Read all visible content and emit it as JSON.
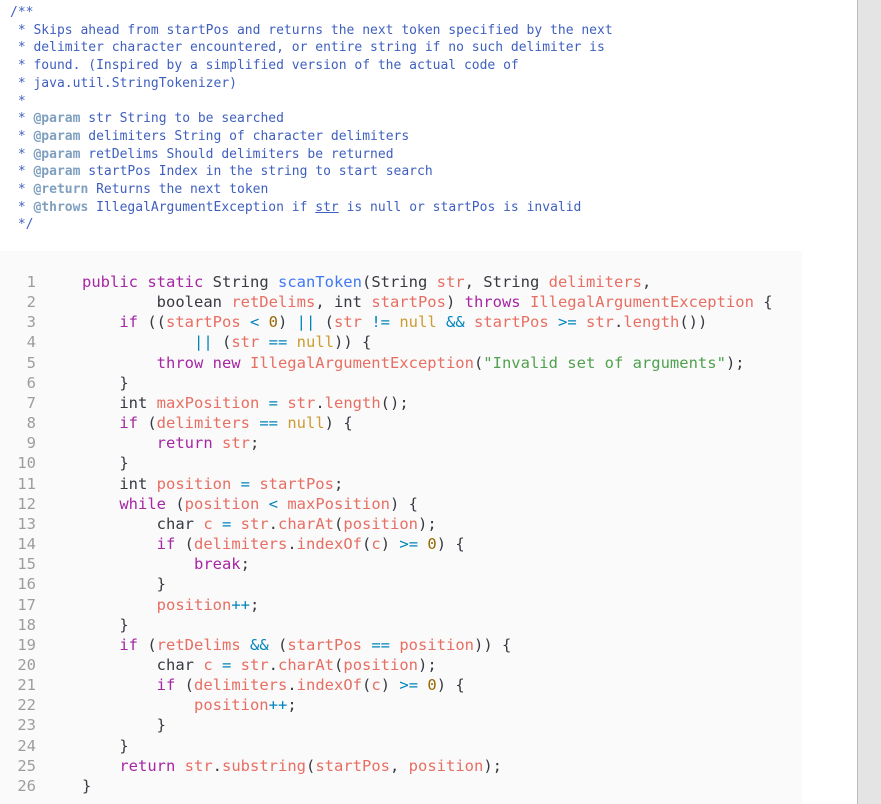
{
  "javadoc": {
    "open": "/**",
    "lines": [
      " * Skips ahead from startPos and returns the next token specified by the next",
      " * delimiter character encountered, or entire string if no such delimiter is",
      " * found. (Inspired by a simplified version of the actual code of",
      " * java.util.StringTokenizer)",
      " *"
    ],
    "tags": [
      {
        "tag": "@param",
        "text": " str String to be searched"
      },
      {
        "tag": "@param",
        "text": " delimiters String of character delimiters"
      },
      {
        "tag": "@param",
        "text": " retDelims Should delimiters be returned"
      },
      {
        "tag": "@param",
        "text": " startPos Index in the string to start search"
      },
      {
        "tag": "@return",
        "text": " Returns the next token"
      },
      {
        "tag": "@throws",
        "text_pre": " IllegalArgumentException if ",
        "underlined": "str",
        "text_post": " is null or startPos is invalid"
      }
    ],
    "close": " */"
  },
  "code": {
    "line_numbers": [
      "1",
      "2",
      "3",
      "4",
      "5",
      "6",
      "7",
      "8",
      "9",
      "10",
      "11",
      "12",
      "13",
      "14",
      "15",
      "16",
      "17",
      "18",
      "19",
      "20",
      "21",
      "22",
      "23",
      "24",
      "25",
      "26"
    ],
    "lines": [
      [
        [
          "kw",
          "public static "
        ],
        [
          "t",
          "String "
        ],
        [
          "fn",
          "scanToken"
        ],
        [
          "t",
          "(String "
        ],
        [
          "var",
          "str"
        ],
        [
          "t",
          ", String "
        ],
        [
          "var",
          "delimiters"
        ],
        [
          "t",
          ","
        ]
      ],
      [
        [
          "t",
          "        boolean "
        ],
        [
          "var",
          "retDelims"
        ],
        [
          "t",
          ", int "
        ],
        [
          "var",
          "startPos"
        ],
        [
          "t",
          ") "
        ],
        [
          "kw",
          "throws "
        ],
        [
          "var",
          "IllegalArgumentException"
        ],
        [
          "t",
          " {"
        ]
      ],
      [
        [
          "t",
          "    "
        ],
        [
          "kw",
          "if "
        ],
        [
          "t",
          "(("
        ],
        [
          "var",
          "startPos"
        ],
        [
          "op",
          " < "
        ],
        [
          "num",
          "0"
        ],
        [
          "t",
          ") "
        ],
        [
          "op",
          "||"
        ],
        [
          "t",
          " ("
        ],
        [
          "var",
          "str"
        ],
        [
          "op",
          " != "
        ],
        [
          "lit",
          "null"
        ],
        [
          "op",
          " && "
        ],
        [
          "var",
          "startPos"
        ],
        [
          "op",
          " >= "
        ],
        [
          "var",
          "str"
        ],
        [
          "t",
          "."
        ],
        [
          "var",
          "length"
        ],
        [
          "t",
          "())"
        ]
      ],
      [
        [
          "t",
          "            "
        ],
        [
          "op",
          "||"
        ],
        [
          "t",
          " ("
        ],
        [
          "var",
          "str"
        ],
        [
          "op",
          " == "
        ],
        [
          "lit",
          "null"
        ],
        [
          "t",
          ")) {"
        ]
      ],
      [
        [
          "t",
          "        "
        ],
        [
          "kw",
          "throw new "
        ],
        [
          "var",
          "IllegalArgumentException"
        ],
        [
          "t",
          "("
        ],
        [
          "str",
          "\"Invalid set of arguments\""
        ],
        [
          "t",
          ");"
        ]
      ],
      [
        [
          "t",
          "    }"
        ]
      ],
      [
        [
          "t",
          "    int "
        ],
        [
          "var",
          "maxPosition"
        ],
        [
          "op",
          " = "
        ],
        [
          "var",
          "str"
        ],
        [
          "t",
          "."
        ],
        [
          "var",
          "length"
        ],
        [
          "t",
          "();"
        ]
      ],
      [
        [
          "t",
          "    "
        ],
        [
          "kw",
          "if "
        ],
        [
          "t",
          "("
        ],
        [
          "var",
          "delimiters"
        ],
        [
          "op",
          " == "
        ],
        [
          "lit",
          "null"
        ],
        [
          "t",
          ") {"
        ]
      ],
      [
        [
          "t",
          "        "
        ],
        [
          "kw",
          "return "
        ],
        [
          "var",
          "str"
        ],
        [
          "t",
          ";"
        ]
      ],
      [
        [
          "t",
          "    }"
        ]
      ],
      [
        [
          "t",
          "    int "
        ],
        [
          "var",
          "position"
        ],
        [
          "op",
          " = "
        ],
        [
          "var",
          "startPos"
        ],
        [
          "t",
          ";"
        ]
      ],
      [
        [
          "t",
          "    "
        ],
        [
          "kw",
          "while "
        ],
        [
          "t",
          "("
        ],
        [
          "var",
          "position"
        ],
        [
          "op",
          " < "
        ],
        [
          "var",
          "maxPosition"
        ],
        [
          "t",
          ") {"
        ]
      ],
      [
        [
          "t",
          "        char "
        ],
        [
          "var",
          "c"
        ],
        [
          "op",
          " = "
        ],
        [
          "var",
          "str"
        ],
        [
          "t",
          "."
        ],
        [
          "var",
          "charAt"
        ],
        [
          "t",
          "("
        ],
        [
          "var",
          "position"
        ],
        [
          "t",
          ");"
        ]
      ],
      [
        [
          "t",
          "        "
        ],
        [
          "kw",
          "if "
        ],
        [
          "t",
          "("
        ],
        [
          "var",
          "delimiters"
        ],
        [
          "t",
          "."
        ],
        [
          "var",
          "indexOf"
        ],
        [
          "t",
          "("
        ],
        [
          "var",
          "c"
        ],
        [
          "t",
          ")"
        ],
        [
          "op",
          " >= "
        ],
        [
          "num",
          "0"
        ],
        [
          "t",
          ") {"
        ]
      ],
      [
        [
          "t",
          "            "
        ],
        [
          "kw",
          "break"
        ],
        [
          "t",
          ";"
        ]
      ],
      [
        [
          "t",
          "        }"
        ]
      ],
      [
        [
          "t",
          "        "
        ],
        [
          "var",
          "position"
        ],
        [
          "op",
          "++"
        ],
        [
          "t",
          ";"
        ]
      ],
      [
        [
          "t",
          "    }"
        ]
      ],
      [
        [
          "t",
          "    "
        ],
        [
          "kw",
          "if "
        ],
        [
          "t",
          "("
        ],
        [
          "var",
          "retDelims"
        ],
        [
          "op",
          " && "
        ],
        [
          "t",
          "("
        ],
        [
          "var",
          "startPos"
        ],
        [
          "op",
          " == "
        ],
        [
          "var",
          "position"
        ],
        [
          "t",
          ")) {"
        ]
      ],
      [
        [
          "t",
          "        char "
        ],
        [
          "var",
          "c"
        ],
        [
          "op",
          " = "
        ],
        [
          "var",
          "str"
        ],
        [
          "t",
          "."
        ],
        [
          "var",
          "charAt"
        ],
        [
          "t",
          "("
        ],
        [
          "var",
          "position"
        ],
        [
          "t",
          ");"
        ]
      ],
      [
        [
          "t",
          "        "
        ],
        [
          "kw",
          "if "
        ],
        [
          "t",
          "("
        ],
        [
          "var",
          "delimiters"
        ],
        [
          "t",
          "."
        ],
        [
          "var",
          "indexOf"
        ],
        [
          "t",
          "("
        ],
        [
          "var",
          "c"
        ],
        [
          "t",
          ")"
        ],
        [
          "op",
          " >= "
        ],
        [
          "num",
          "0"
        ],
        [
          "t",
          ") {"
        ]
      ],
      [
        [
          "t",
          "            "
        ],
        [
          "var",
          "position"
        ],
        [
          "op",
          "++"
        ],
        [
          "t",
          ";"
        ]
      ],
      [
        [
          "t",
          "        }"
        ]
      ],
      [
        [
          "t",
          "    }"
        ]
      ],
      [
        [
          "t",
          "    "
        ],
        [
          "kw",
          "return "
        ],
        [
          "var",
          "str"
        ],
        [
          "t",
          "."
        ],
        [
          "var",
          "substring"
        ],
        [
          "t",
          "("
        ],
        [
          "var",
          "startPos"
        ],
        [
          "t",
          ", "
        ],
        [
          "var",
          "position"
        ],
        [
          "t",
          ");"
        ]
      ],
      [
        [
          "t",
          "}"
        ]
      ]
    ]
  },
  "colors": {
    "javadoc_text": "#3f5fbf",
    "javadoc_tag": "#7f9fbf",
    "keyword": "#a626a4",
    "function": "#4078f2",
    "variable": "#e45649",
    "number": "#986801",
    "operator": "#0184bc",
    "string": "#50a14f",
    "code_background": "#fafafa"
  }
}
